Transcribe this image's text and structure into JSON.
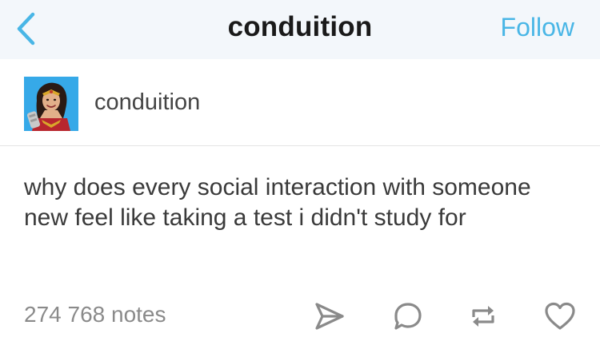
{
  "header": {
    "title": "conduition",
    "follow_label": "Follow",
    "back_icon": "chevron-left-icon",
    "accent_color": "#49b6e6"
  },
  "author": {
    "name": "conduition",
    "avatar_icon": "avatar-illustration",
    "avatar_bg": "#36a9e8"
  },
  "post": {
    "text": "why does every social interaction with someone new feel like taking a test i didn't study for"
  },
  "footer": {
    "notes": "274 768 notes",
    "actions": [
      "share-icon",
      "reply-icon",
      "reblog-icon",
      "like-icon"
    ]
  }
}
